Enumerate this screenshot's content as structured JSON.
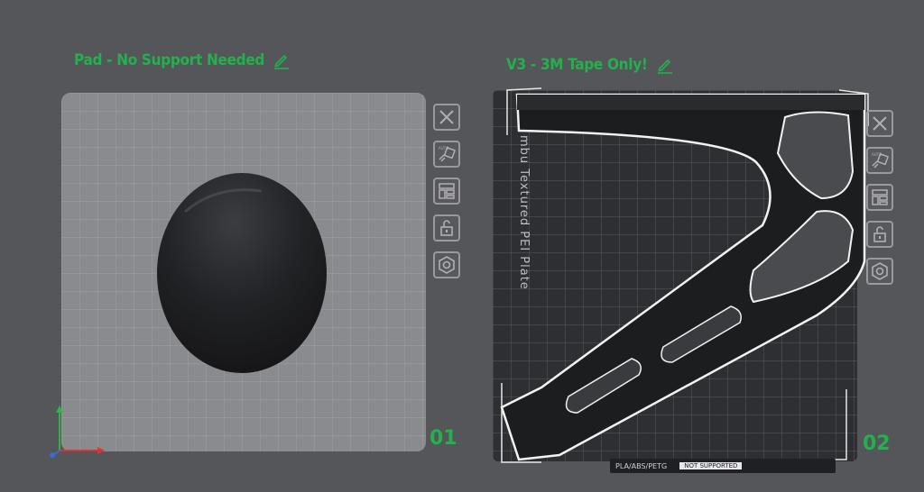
{
  "plates": [
    {
      "title": "Pad - No Support Needed",
      "number": "01"
    },
    {
      "title": "V3 - 3M Tape Only!",
      "number": "02",
      "plate_label": "mbu Textured PEI Plate",
      "footer": {
        "filament": "PLA/ABS/PETG",
        "support": "NOT SUPPORTED"
      }
    }
  ],
  "toolbar_icons": [
    "close-icon",
    "auto-orient-icon",
    "arrange-icon",
    "lock-icon",
    "settings-icon"
  ],
  "colors": {
    "accent": "#22b14c",
    "background": "#555659"
  }
}
